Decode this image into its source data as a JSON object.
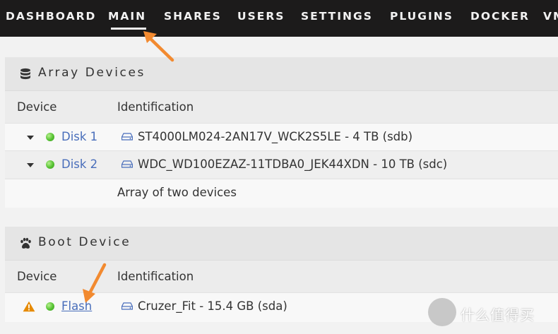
{
  "nav": {
    "tabs": [
      {
        "label": "DASHBOARD"
      },
      {
        "label": "MAIN"
      },
      {
        "label": "SHARES"
      },
      {
        "label": "USERS"
      },
      {
        "label": "SETTINGS"
      },
      {
        "label": "PLUGINS"
      },
      {
        "label": "DOCKER"
      },
      {
        "label": "VM"
      }
    ],
    "active": "MAIN"
  },
  "array_devices": {
    "title": "Array Devices",
    "icon": "database-icon",
    "col_device": "Device",
    "col_identification": "Identification",
    "rows": [
      {
        "device": "Disk 1",
        "identification": "ST4000LM024-2AN17V_WCK2S5LE - 4 TB (sdb)",
        "status": "green"
      },
      {
        "device": "Disk 2",
        "identification": "WDC_WD100EZAZ-11TDBA0_JEK44XDN - 10 TB (sdc)",
        "status": "green"
      }
    ],
    "summary": "Array of two devices"
  },
  "boot_device": {
    "title": "Boot Device",
    "icon": "paw-icon",
    "col_device": "Device",
    "col_identification": "Identification",
    "rows": [
      {
        "device": "Flash",
        "identification": "Cruzer_Fit - 15.4 GB (sda)",
        "status": "green",
        "warning": true
      }
    ]
  },
  "watermark": {
    "text": "什么值得买"
  },
  "colors": {
    "nav_bg": "#1c1b1b",
    "link": "#486dba",
    "status_green": "#54c131",
    "warning": "#e68a00",
    "annotation_arrow": "#f28a30"
  }
}
